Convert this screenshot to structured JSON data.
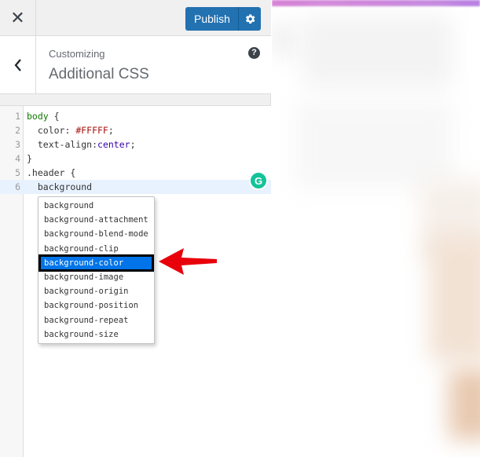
{
  "topbar": {
    "close_icon": "close-icon",
    "publish_label": "Publish",
    "settings_icon": "gear-icon"
  },
  "section": {
    "subtitle": "Customizing",
    "title": "Additional CSS",
    "help_label": "?"
  },
  "editor": {
    "lines": [
      {
        "num": "1",
        "text": "body {"
      },
      {
        "num": "2",
        "text": "  color: #FFFFF;"
      },
      {
        "num": "3",
        "text": "  text-align:center;"
      },
      {
        "num": "4",
        "text": "}"
      },
      {
        "num": "5",
        "text": ".header {"
      },
      {
        "num": "6",
        "text": "  background"
      }
    ],
    "tokens": {
      "l1_sel": "body",
      "l1_brace": " {",
      "l2_prop": "  color: ",
      "l2_val": "#FFFFF",
      "l2_end": ";",
      "l3_prop": "  text-align:",
      "l3_val": "center",
      "l3_end": ";",
      "l4": "}",
      "l5": ".header {",
      "l6": "  background"
    }
  },
  "autocomplete": {
    "items": [
      "background",
      "background-attachment",
      "background-blend-mode",
      "background-clip",
      "background-color",
      "background-image",
      "background-origin",
      "background-position",
      "background-repeat",
      "background-size"
    ],
    "selected": "background-color"
  },
  "colors": {
    "publish": "#2271b1",
    "selection": "#0074e8",
    "arrow": "#e8000b",
    "grammarly": "#15c39a"
  }
}
